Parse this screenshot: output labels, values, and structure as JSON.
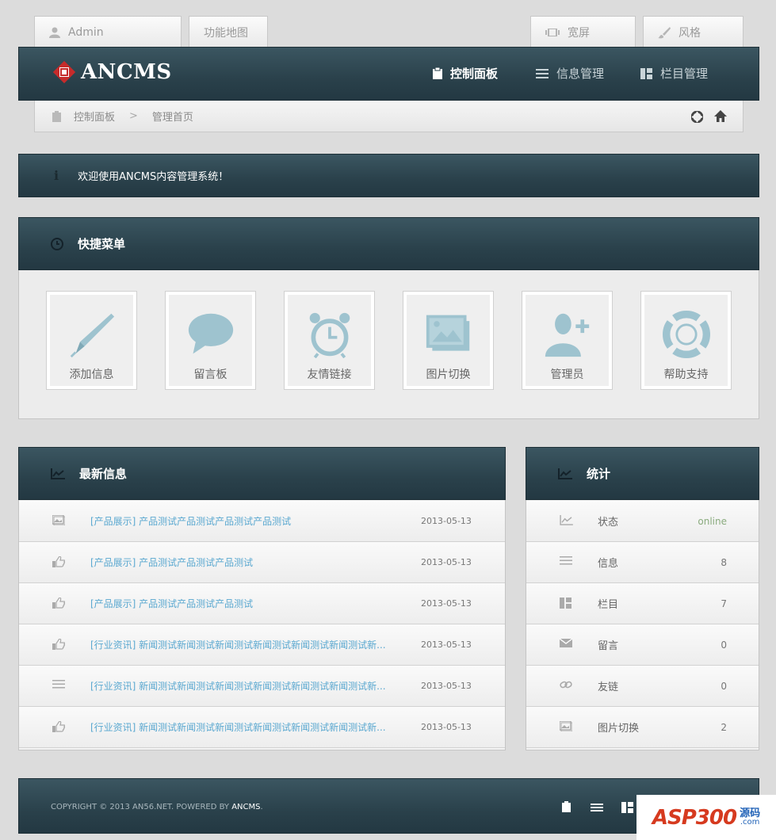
{
  "topbar": {
    "admin_label": "Admin",
    "sitemap_label": "功能地图",
    "widescreen_label": "宽屏",
    "style_label": "风格"
  },
  "header": {
    "logo_text": "ANCMS",
    "nav": [
      {
        "label": "控制面板",
        "icon": "clipboard-icon"
      },
      {
        "label": "信息管理",
        "icon": "list-icon"
      },
      {
        "label": "栏目管理",
        "icon": "columns-icon"
      }
    ]
  },
  "breadcrumb": {
    "items": [
      "控制面板",
      "管理首页"
    ],
    "separator": ">"
  },
  "notice": {
    "text": "欢迎使用ANCMS内容管理系统！"
  },
  "quick_menu": {
    "title": "快捷菜单",
    "items": [
      {
        "label": "添加信息",
        "icon": "pen-icon"
      },
      {
        "label": "留言板",
        "icon": "speech-bubble-icon"
      },
      {
        "label": "友情链接",
        "icon": "alarm-clock-icon"
      },
      {
        "label": "图片切换",
        "icon": "image-stack-icon"
      },
      {
        "label": "管理员",
        "icon": "add-user-icon"
      },
      {
        "label": "帮助支持",
        "icon": "lifebuoy-icon"
      }
    ]
  },
  "latest": {
    "title": "最新信息",
    "rows": [
      {
        "icon": "image-icon",
        "title": "[产品展示] 产品测试产品测试产品测试产品测试",
        "date": "2013-05-13"
      },
      {
        "icon": "thumbs-up-icon",
        "title": "[产品展示] 产品测试产品测试产品测试",
        "date": "2013-05-13"
      },
      {
        "icon": "thumbs-up-icon",
        "title": "[产品展示] 产品测试产品测试产品测试",
        "date": "2013-05-13"
      },
      {
        "icon": "thumbs-up-icon",
        "title": "[行业资讯] 新闻测试新闻测试新闻测试新闻测试新闻测试新闻测试新...",
        "date": "2013-05-13"
      },
      {
        "icon": "list-icon",
        "title": "[行业资讯] 新闻测试新闻测试新闻测试新闻测试新闻测试新闻测试新...",
        "date": "2013-05-13"
      },
      {
        "icon": "thumbs-up-icon",
        "title": "[行业资讯] 新闻测试新闻测试新闻测试新闻测试新闻测试新闻测试新...",
        "date": "2013-05-13"
      }
    ]
  },
  "stats": {
    "title": "统计",
    "rows": [
      {
        "icon": "chart-icon",
        "label": "状态",
        "value": "online"
      },
      {
        "icon": "list-icon",
        "label": "信息",
        "value": "8"
      },
      {
        "icon": "columns-icon",
        "label": "栏目",
        "value": "7"
      },
      {
        "icon": "mail-icon",
        "label": "留言",
        "value": "0"
      },
      {
        "icon": "link-icon",
        "label": "友链",
        "value": "0"
      },
      {
        "icon": "image-icon",
        "label": "图片切换",
        "value": "2"
      }
    ]
  },
  "footer": {
    "copyright_prefix": "COPYRIGHT © 2013 AN56.NET. POWERED BY",
    "copyright_brand": "ANCMS",
    "copyright_suffix": "."
  },
  "watermark": {
    "main": "ASP300",
    "side_top": "源码",
    "side_bottom": ".com"
  },
  "colors": {
    "header_dark": "#2a414b",
    "link_blue": "#5aa8d0",
    "online_green": "#8aab7e",
    "tile_icon": "#9ec3cf"
  }
}
